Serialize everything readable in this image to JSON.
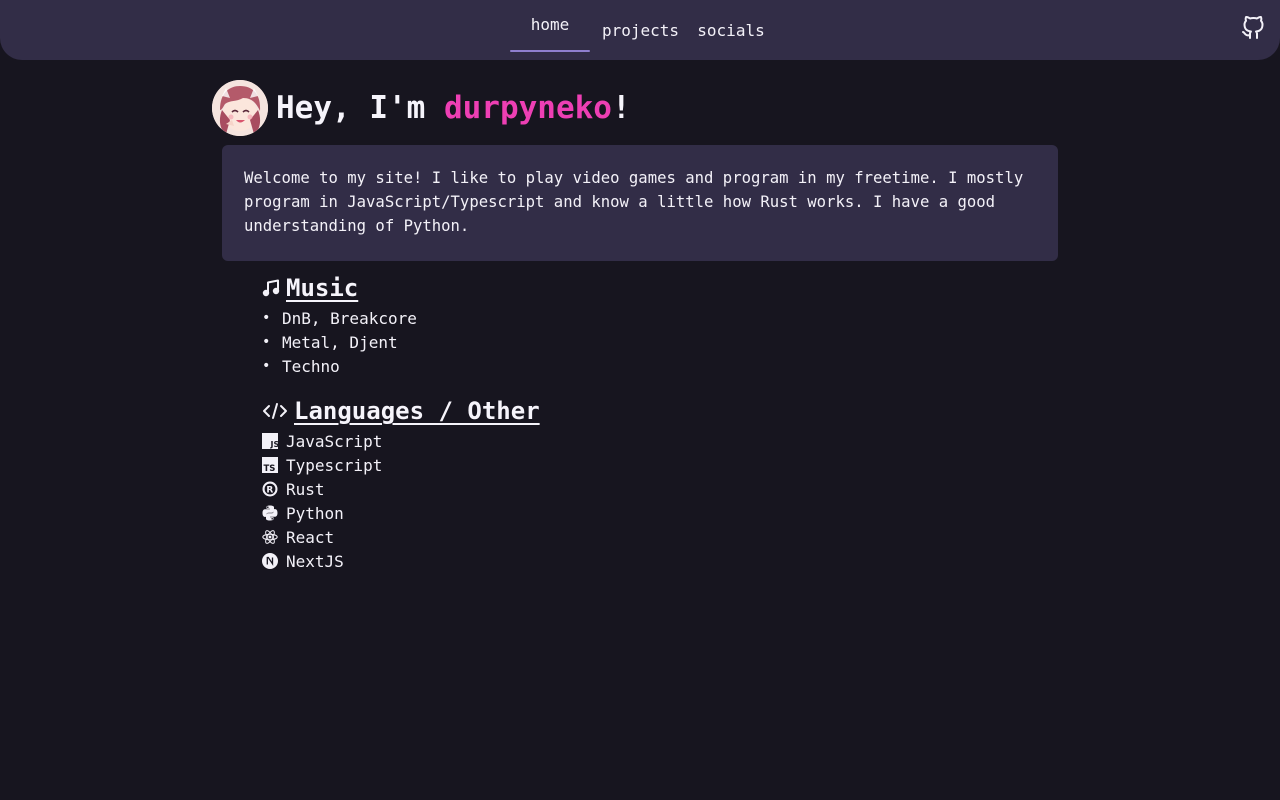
{
  "nav": {
    "links": [
      {
        "label": "home",
        "active": true
      },
      {
        "label": "projects",
        "active": false
      },
      {
        "label": "socials",
        "active": false
      }
    ],
    "github_icon": "github-icon"
  },
  "hero": {
    "prefix": "Hey, I'm ",
    "name": "durpyneko",
    "suffix": "!"
  },
  "intro": {
    "text": "Welcome to my site! I like to play video games and program in my freetime. I mostly program in JavaScript/Typescript and know a little how Rust works. I have a good understanding of Python."
  },
  "music": {
    "icon": "music-note-icon",
    "title": "Music",
    "items": [
      "DnB, Breakcore",
      "Metal, Djent",
      "Techno"
    ]
  },
  "languages": {
    "icon": "code-icon",
    "title": "Languages / Other",
    "items": [
      {
        "label": "JavaScript",
        "icon": "javascript-icon"
      },
      {
        "label": "Typescript",
        "icon": "typescript-icon"
      },
      {
        "label": "Rust",
        "icon": "rust-icon"
      },
      {
        "label": "Python",
        "icon": "python-icon"
      },
      {
        "label": "React",
        "icon": "react-icon"
      },
      {
        "label": "NextJS",
        "icon": "nextjs-icon"
      }
    ]
  },
  "colors": {
    "background": "#17151f",
    "card": "#322d47",
    "accent_name": "#ee3fb4",
    "nav_underline": "#8f7fcf"
  }
}
